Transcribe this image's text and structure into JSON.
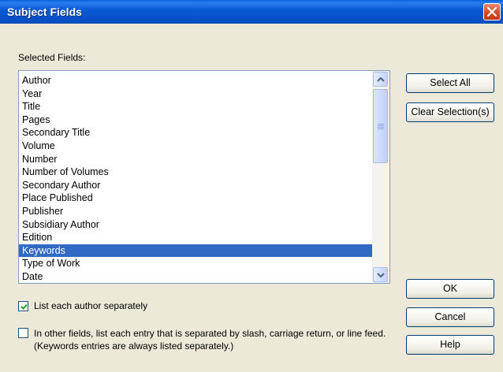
{
  "window": {
    "title": "Subject Fields"
  },
  "selected_fields_label": "Selected Fields:",
  "fields": [
    {
      "label": "Author",
      "selected": false
    },
    {
      "label": "Year",
      "selected": false
    },
    {
      "label": "Title",
      "selected": false
    },
    {
      "label": "Pages",
      "selected": false
    },
    {
      "label": "Secondary Title",
      "selected": false
    },
    {
      "label": "Volume",
      "selected": false
    },
    {
      "label": "Number",
      "selected": false
    },
    {
      "label": "Number of Volumes",
      "selected": false
    },
    {
      "label": "Secondary Author",
      "selected": false
    },
    {
      "label": "Place Published",
      "selected": false
    },
    {
      "label": "Publisher",
      "selected": false
    },
    {
      "label": "Subsidiary Author",
      "selected": false
    },
    {
      "label": "Edition",
      "selected": false
    },
    {
      "label": "Keywords",
      "selected": true
    },
    {
      "label": "Type of Work",
      "selected": false
    },
    {
      "label": "Date",
      "selected": false
    }
  ],
  "buttons": {
    "select_all": "Select All",
    "clear_selection": "Clear Selection(s)",
    "ok": "OK",
    "cancel": "Cancel",
    "help": "Help"
  },
  "options": {
    "list_each_author": {
      "label": "List each author separately",
      "checked": true
    },
    "list_each_entry": {
      "label": "In other fields, list each entry that is separated by slash, carriage return, or line feed. (Keywords entries are always listed separately.)",
      "checked": false
    }
  },
  "colors": {
    "selection": "#316ac5",
    "title_bar": "#0b5ad6",
    "close_button": "#d2451f",
    "dialog_bg": "#ece9d8"
  }
}
